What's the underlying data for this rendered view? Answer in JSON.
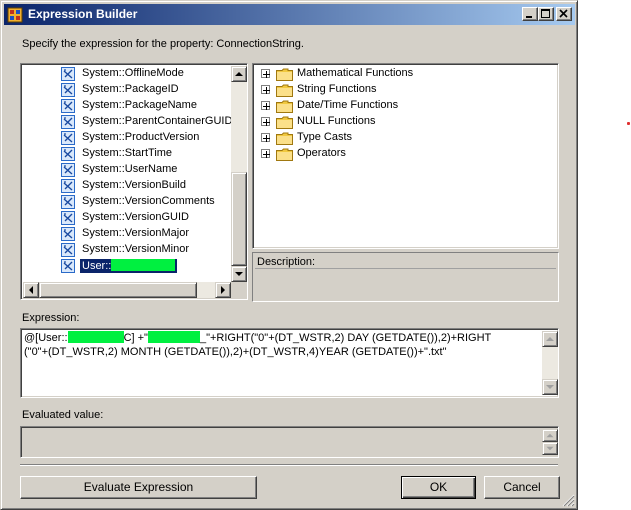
{
  "window": {
    "title": "Expression Builder",
    "prompt": "Specify the expression for the property: ConnectionString."
  },
  "variables": {
    "items": [
      "System::OfflineMode",
      "System::PackageID",
      "System::PackageName",
      "System::ParentContainerGUID",
      "System::ProductVersion",
      "System::StartTime",
      "System::UserName",
      "System::VersionBuild",
      "System::VersionComments",
      "System::VersionGUID",
      "System::VersionMajor",
      "System::VersionMinor"
    ],
    "selected_prefix": "User::"
  },
  "functions": {
    "items": [
      "Mathematical Functions",
      "String Functions",
      "Date/Time Functions",
      "NULL Functions",
      "Type Casts",
      "Operators"
    ]
  },
  "description": {
    "label": "Description:"
  },
  "expression": {
    "label": "Expression:",
    "part1": "@[User::",
    "part2": "C] +\"",
    "part3": "_\"+RIGHT(\"0\"+(DT_WSTR,2) DAY (GETDATE()),2)+RIGHT",
    "line2": "(\"0\"+(DT_WSTR,2) MONTH (GETDATE()),2)+(DT_WSTR,4)YEAR (GETDATE())+\".txt\""
  },
  "evaluated": {
    "label": "Evaluated value:",
    "value": ""
  },
  "buttons": {
    "evaluate": "Evaluate Expression",
    "ok": "OK",
    "cancel": "Cancel"
  },
  "colors": {
    "title_start": "#0a246a",
    "title_end": "#a6caf0",
    "dialog_face": "#d4d0c8",
    "redaction": "#00f040",
    "folder": "#f0c840"
  }
}
